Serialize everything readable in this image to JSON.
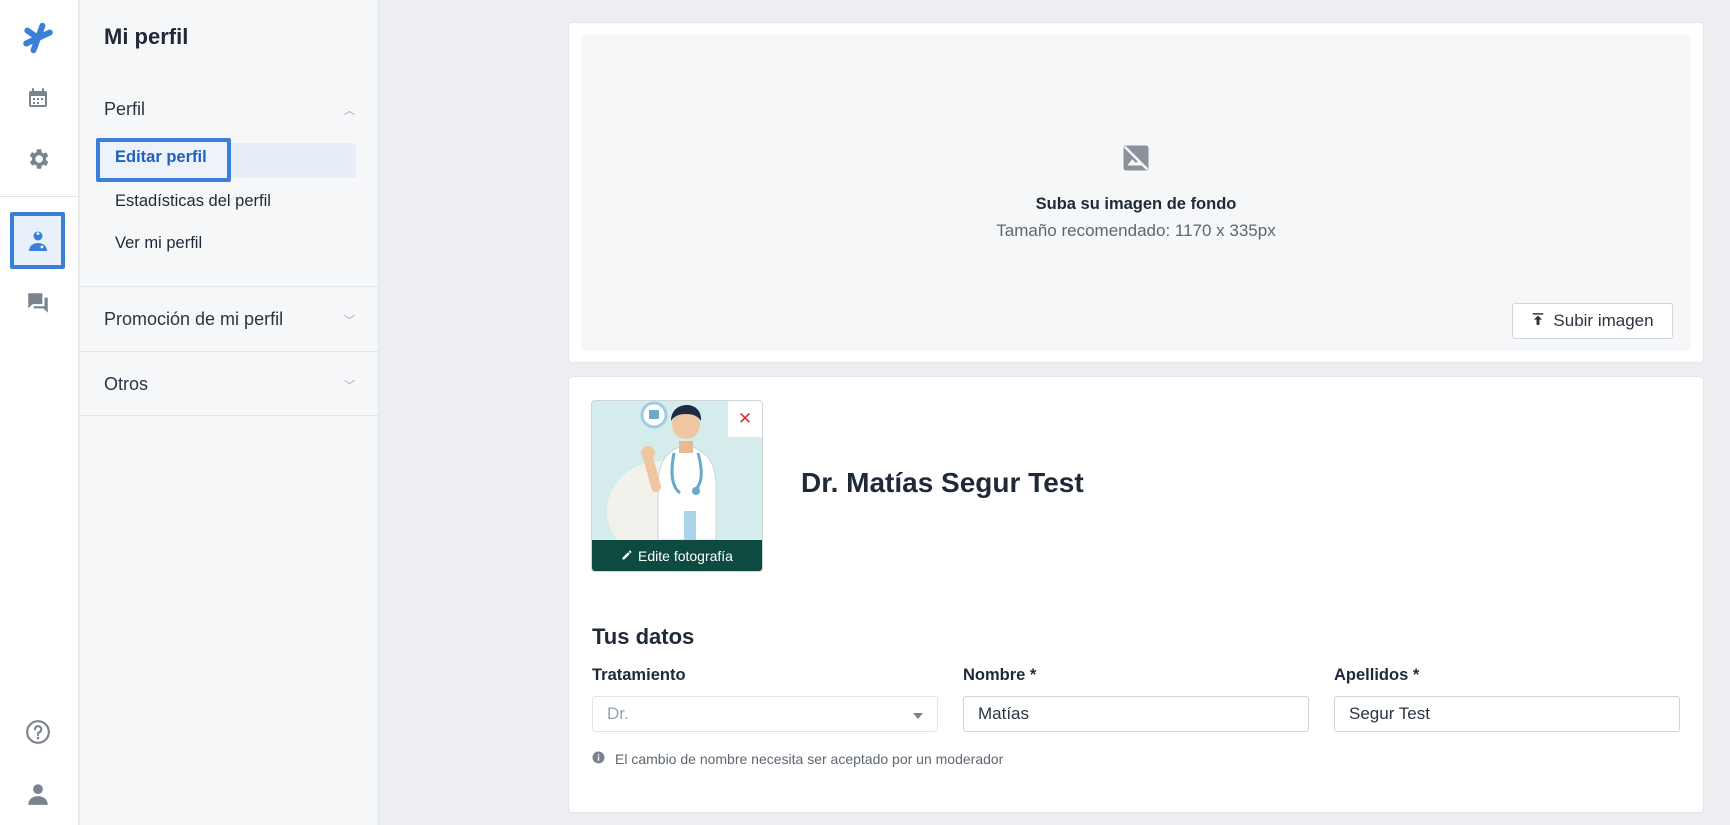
{
  "nav_rail": {
    "logo": "logo-icon",
    "items": [
      "calendar-icon",
      "settings-icon",
      "doctor-profile-icon",
      "messages-icon"
    ],
    "bottom": [
      "help-icon",
      "user-icon"
    ]
  },
  "sidebar": {
    "title": "Mi perfil",
    "sections": [
      {
        "label": "Perfil",
        "expanded": true,
        "items": [
          "Editar perfil",
          "Estadísticas del perfil",
          "Ver mi perfil"
        ],
        "active": "Editar perfil"
      },
      {
        "label": "Promoción de mi perfil",
        "expanded": false
      },
      {
        "label": "Otros",
        "expanded": false
      }
    ]
  },
  "cover": {
    "title": "Suba su imagen de fondo",
    "subtitle": "Tamaño recomendado: 1170 x 335px",
    "upload_label": "Subir imagen"
  },
  "profile": {
    "photo_edit_label": "Edite fotografía",
    "name": "Dr. Matías Segur Test"
  },
  "form": {
    "heading": "Tus datos",
    "fields": [
      {
        "label": "Tratamiento",
        "placeholder": "Dr."
      },
      {
        "label": "Nombre *",
        "value": "Matías"
      },
      {
        "label": "Apellidos *",
        "value": "Segur Test"
      }
    ],
    "hint": "El cambio de nombre necesita ser aceptado por un moderador"
  },
  "colors": {
    "accent": "#3b7fd9",
    "brand": "#3b7fd9",
    "photo_bar": "#0d4a40",
    "remove": "#d23a3a"
  }
}
